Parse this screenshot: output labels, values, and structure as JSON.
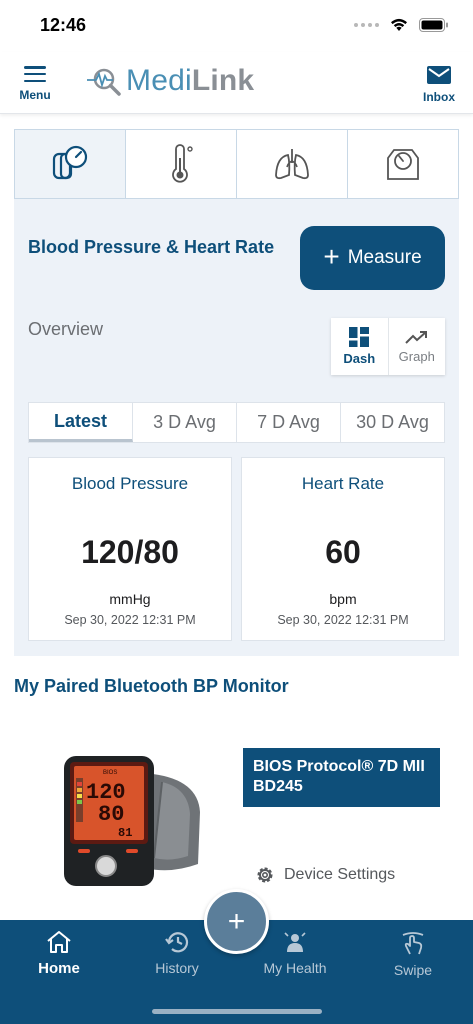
{
  "status_bar": {
    "time": "12:46"
  },
  "header": {
    "menu_label": "Menu",
    "logo_main": "Medi",
    "logo_bold": "Link",
    "inbox_label": "Inbox"
  },
  "type_tabs": [
    {
      "icon": "blood-pressure-icon"
    },
    {
      "icon": "thermometer-icon"
    },
    {
      "icon": "lungs-icon"
    },
    {
      "icon": "scale-icon"
    }
  ],
  "section": {
    "title": "Blood Pressure & Heart Rate",
    "measure_plus": "+",
    "measure_label": "Measure",
    "overview_label": "Overview",
    "view_dash": "Dash",
    "view_graph": "Graph"
  },
  "period_tabs": [
    "Latest",
    "3 D Avg",
    "7 D Avg",
    "30 D Avg"
  ],
  "metrics": [
    {
      "title": "Blood Pressure",
      "value": "120/80",
      "unit": "mmHg",
      "date": "Sep 30, 2022 12:31 PM"
    },
    {
      "title": "Heart Rate",
      "value": "60",
      "unit": "bpm",
      "date": "Sep 30, 2022 12:31 PM"
    }
  ],
  "device": {
    "section_title": "My Paired Bluetooth BP Monitor",
    "name": "BIOS Protocol® 7D MII BD245",
    "settings_label": "Device Settings",
    "display": {
      "brand": "BIOS",
      "sys": "120",
      "dia": "80",
      "pulse": "81"
    }
  },
  "fab_label": "+",
  "bottom_nav": {
    "home": "Home",
    "history": "History",
    "health": "My Health",
    "swipe": "Swipe"
  },
  "colors": {
    "primary": "#0e4f7a",
    "panel_bg": "#edf2f8",
    "logo_blue": "#4a8fb4",
    "logo_gray": "#8a8f95"
  }
}
